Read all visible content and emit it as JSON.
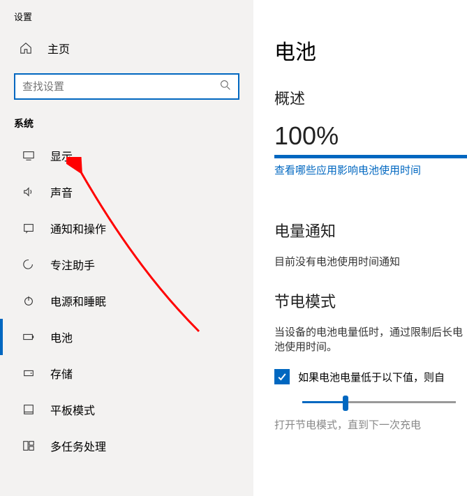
{
  "topbar": {
    "title": "设置"
  },
  "home": {
    "label": "主页"
  },
  "search": {
    "placeholder": "查找设置"
  },
  "system": {
    "label": "系统"
  },
  "nav": {
    "items": [
      {
        "label": "显示"
      },
      {
        "label": "声音"
      },
      {
        "label": "通知和操作"
      },
      {
        "label": "专注助手"
      },
      {
        "label": "电源和睡眠"
      },
      {
        "label": "电池"
      },
      {
        "label": "存储"
      },
      {
        "label": "平板模式"
      },
      {
        "label": "多任务处理"
      }
    ]
  },
  "page": {
    "title": "电池",
    "overview": {
      "heading": "概述",
      "percent": "100%",
      "link": "查看哪些应用影响电池使用时间"
    },
    "notify": {
      "heading": "电量通知",
      "text": "目前没有电池使用时间通知"
    },
    "saver": {
      "heading": "节电模式",
      "desc": "当设备的电池电量低时，通过限制后长电池使用时间。",
      "checkbox_label": "如果电池电量低于以下值，则自",
      "slider_percent": 28,
      "note": "打开节电模式，直到下一次充电"
    }
  }
}
